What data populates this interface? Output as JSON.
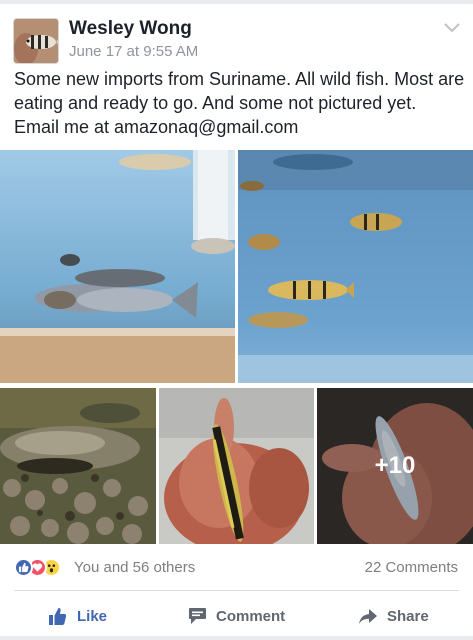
{
  "post": {
    "author": "Wesley Wong",
    "timestamp": "June 17 at 9:55 AM",
    "text": "Some new imports from Suriname.  All wild fish.  Most are eating and ready to go.  And some not pictured yet.  Email me at amazonaq@gmail.com"
  },
  "photos": {
    "count": 5,
    "more_label": "+10"
  },
  "reactions": {
    "types": [
      "like",
      "love",
      "wow"
    ],
    "summary": "You and 56 others",
    "comments": "22 Comments"
  },
  "actions": {
    "like": "Like",
    "comment": "Comment",
    "share": "Share"
  },
  "colors": {
    "accent": "#4267b2",
    "love": "#f25268",
    "wow": "#fcd441",
    "secondary_text": "#90949c"
  },
  "icons": [
    "chevron-down-icon",
    "like-icon",
    "comment-icon",
    "share-icon",
    "love-icon",
    "wow-icon"
  ]
}
